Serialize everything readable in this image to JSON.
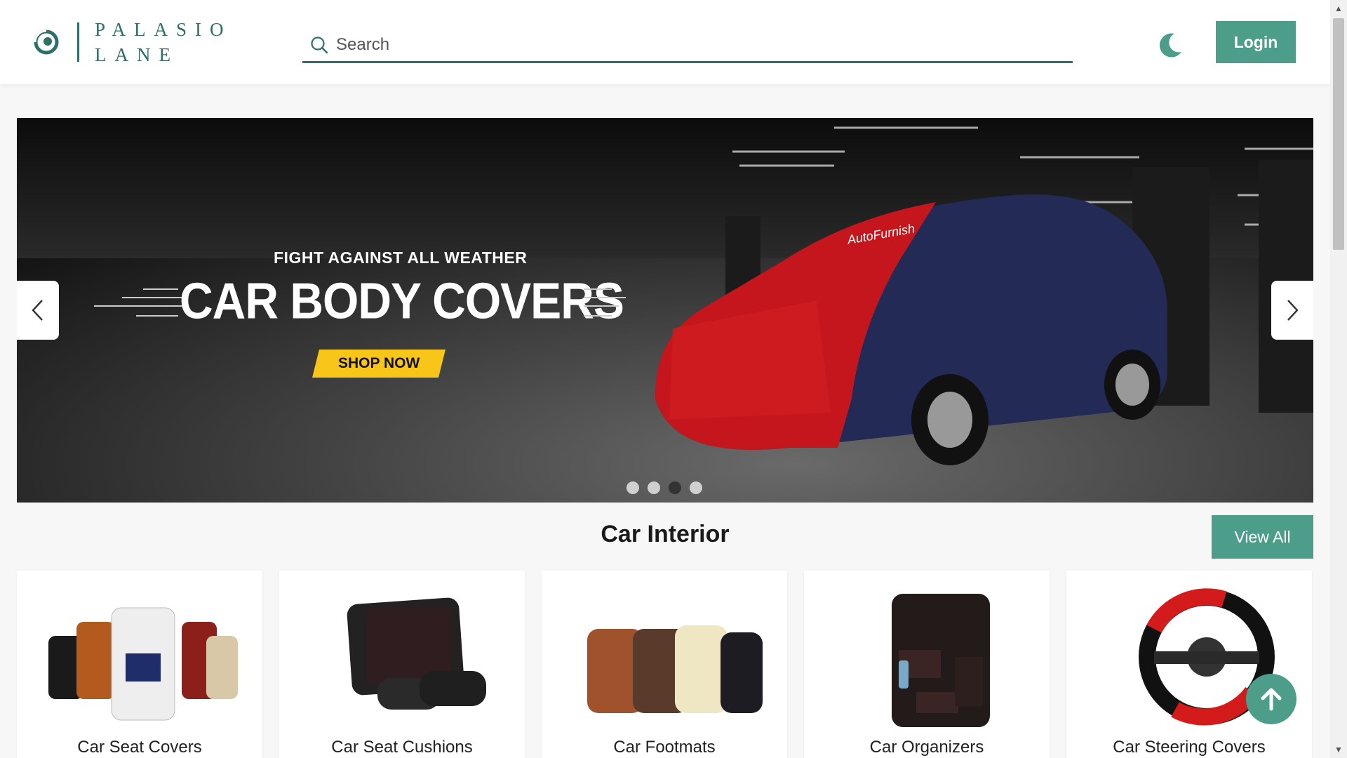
{
  "brand": {
    "line1": "PALASIO",
    "line2": "LANE"
  },
  "search": {
    "placeholder": "Search"
  },
  "header": {
    "login_label": "Login"
  },
  "banner": {
    "tagline": "FIGHT AGAINST ALL WEATHER",
    "title": "CAR BODY COVERS",
    "cta": "SHOP NOW",
    "slide_count": 4,
    "active_slide": 3
  },
  "section": {
    "title": "Car Interior",
    "view_all_label": "View All"
  },
  "categories": [
    {
      "label": "Car Seat Covers"
    },
    {
      "label": "Car Seat Cushions"
    },
    {
      "label": "Car Footmats"
    },
    {
      "label": "Car Organizers"
    },
    {
      "label": "Car Steering Covers"
    }
  ],
  "colors": {
    "accent": "#4c9e8a",
    "brand": "#2f6f6a",
    "cta": "#f7c619"
  }
}
